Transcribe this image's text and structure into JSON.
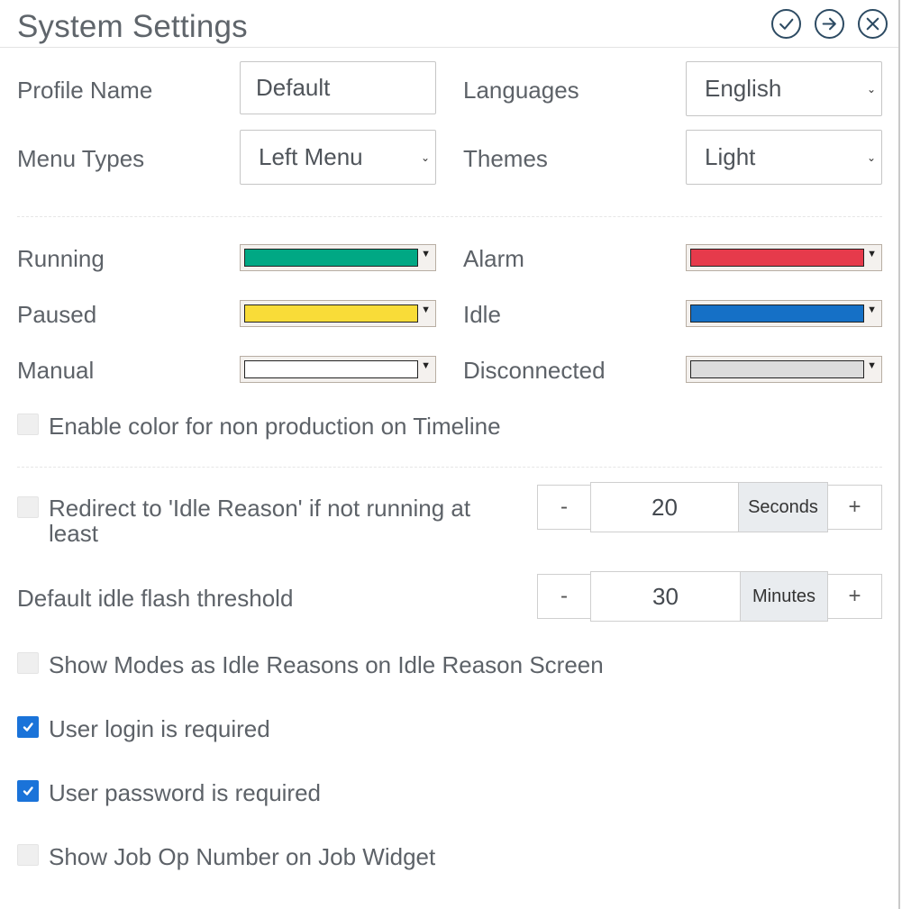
{
  "title": "System Settings",
  "header_actions": {
    "confirm_icon": "check-circle-icon",
    "next_icon": "arrow-right-circle-icon",
    "close_icon": "close-circle-icon"
  },
  "profile": {
    "label": "Profile Name",
    "value": "Default"
  },
  "languages": {
    "label": "Languages",
    "selected": "English"
  },
  "menu_types": {
    "label": "Menu Types",
    "selected": "Left Menu"
  },
  "themes": {
    "label": "Themes",
    "selected": "Light"
  },
  "colors": {
    "running": {
      "label": "Running",
      "color": "#00a884"
    },
    "alarm": {
      "label": "Alarm",
      "color": "#e63a4b"
    },
    "paused": {
      "label": "Paused",
      "color": "#f9dc38"
    },
    "idle": {
      "label": "Idle",
      "color": "#1570c6"
    },
    "manual": {
      "label": "Manual",
      "color": "#ffffff"
    },
    "disconnected": {
      "label": "Disconnected",
      "color": "#dcdcdc"
    }
  },
  "enable_color_timeline": {
    "label": "Enable color for non production on Timeline",
    "checked": false
  },
  "redirect_idle": {
    "label": "Redirect to 'Idle Reason' if not running at least",
    "checked": false,
    "minus": "-",
    "value": "20",
    "unit": "Seconds",
    "plus": "+"
  },
  "idle_flash": {
    "label": "Default idle flash threshold",
    "minus": "-",
    "value": "30",
    "unit": "Minutes",
    "plus": "+"
  },
  "show_modes": {
    "label": "Show Modes as Idle Reasons on Idle Reason Screen",
    "checked": false
  },
  "login_required": {
    "label": "User login is required",
    "checked": true
  },
  "password_required": {
    "label": "User password is required",
    "checked": true
  },
  "show_job_op": {
    "label": "Show Job Op Number on Job Widget",
    "checked": false
  },
  "accent_color": "#1a73d9",
  "header_icon_color": "#2d4b63"
}
